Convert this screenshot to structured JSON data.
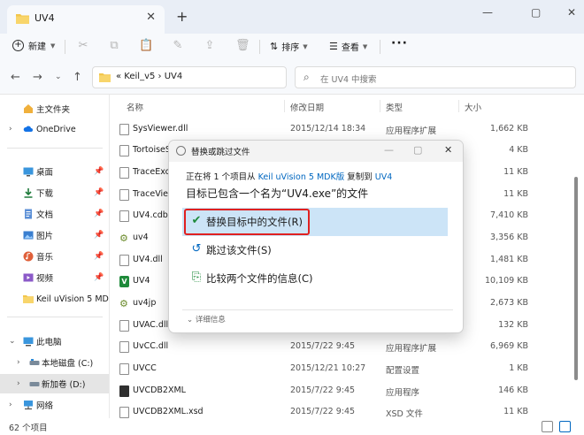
{
  "window": {
    "tab_title": "UV4",
    "close_glyph": "✕",
    "new_tab_glyph": "+",
    "min_glyph": "—",
    "max_glyph": "▢",
    "win_close_glyph": "✕"
  },
  "toolbar": {
    "new_label": "新建",
    "sort_label": "排序",
    "view_label": "查看",
    "more_label": "···"
  },
  "address": {
    "path": "«  Keil_v5  ›  UV4",
    "search_placeholder": "在 UV4 中搜索"
  },
  "sidebar": {
    "items": [
      {
        "label": "主文件夹"
      },
      {
        "label": "OneDrive"
      },
      {
        "label": "桌面"
      },
      {
        "label": "下载"
      },
      {
        "label": "文档"
      },
      {
        "label": "图片"
      },
      {
        "label": "音乐"
      },
      {
        "label": "视频"
      },
      {
        "label": "Keil uVision 5 MD"
      },
      {
        "label": "此电脑"
      },
      {
        "label": "本地磁盘 (C:)"
      },
      {
        "label": "新加卷 (D:)"
      },
      {
        "label": "网络"
      }
    ]
  },
  "columns": {
    "name": "名称",
    "date": "修改日期",
    "type": "类型",
    "size": "大小"
  },
  "files": [
    {
      "name": "SysViewer.dll",
      "date": "2015/12/14 18:34",
      "type": "应用程序扩展",
      "size": "1,662 KB"
    },
    {
      "name": "TortoiseS",
      "date": "",
      "type": "",
      "size": "4 KB"
    },
    {
      "name": "TraceExc",
      "date": "",
      "type": "",
      "size": "11 KB"
    },
    {
      "name": "TraceView",
      "date": "",
      "type": "",
      "size": "11 KB"
    },
    {
      "name": "UV4.cdb",
      "date": "",
      "type": "",
      "size": "7,410 KB"
    },
    {
      "name": "uv4",
      "date": "",
      "type": "",
      "size": "3,356 KB"
    },
    {
      "name": "UV4.dll",
      "date": "",
      "type": "",
      "size": "1,481 KB"
    },
    {
      "name": "UV4",
      "date": "",
      "type": "",
      "size": "10,109 KB"
    },
    {
      "name": "uv4jp",
      "date": "",
      "type": "",
      "size": "2,673 KB"
    },
    {
      "name": "UVAC.dll",
      "date": "",
      "type": "",
      "size": "132 KB"
    },
    {
      "name": "UvCC.dll",
      "date": "2015/7/22 9:45",
      "type": "应用程序扩展",
      "size": "6,969 KB"
    },
    {
      "name": "UVCC",
      "date": "2015/12/21 10:27",
      "type": "配置设置",
      "size": "1 KB"
    },
    {
      "name": "UVCDB2XML",
      "date": "2015/7/22 9:45",
      "type": "应用程序",
      "size": "146 KB"
    },
    {
      "name": "UVCDB2XML.xsd",
      "date": "2015/7/22 9:45",
      "type": "XSD 文件",
      "size": "11 KB"
    }
  ],
  "status": {
    "count": "62 个项目"
  },
  "dialog": {
    "title": "替换或跳过文件",
    "line1_prefix": "正在将 1 个项目从 ",
    "line1_source": "Keil uVision 5 MDK版",
    "line1_mid": " 复制到 ",
    "line1_dest": "UV4",
    "heading": "目标已包含一个名为“UV4.exe”的文件",
    "options": [
      {
        "label": "替换目标中的文件(R)",
        "glyph": "✔"
      },
      {
        "label": "跳过该文件(S)",
        "glyph": "↺"
      },
      {
        "label": "比较两个文件的信息(C)",
        "glyph": "⎘"
      }
    ],
    "details_label": "详细信息",
    "min_glyph": "—",
    "max_glyph": "▢",
    "close_glyph": "✕"
  },
  "colors": {
    "accent": "#0067c0",
    "selection": "#cce4f7",
    "highlight_box": "#e02020",
    "folder": "#f3c64c"
  },
  "icons": {
    "nav": [
      "arrow-left-icon",
      "arrow-right-icon",
      "chevron-down-icon",
      "arrow-up-icon"
    ],
    "toolbar": [
      "cut-icon",
      "copy-icon",
      "paste-icon",
      "rename-icon",
      "share-icon",
      "delete-icon"
    ]
  }
}
